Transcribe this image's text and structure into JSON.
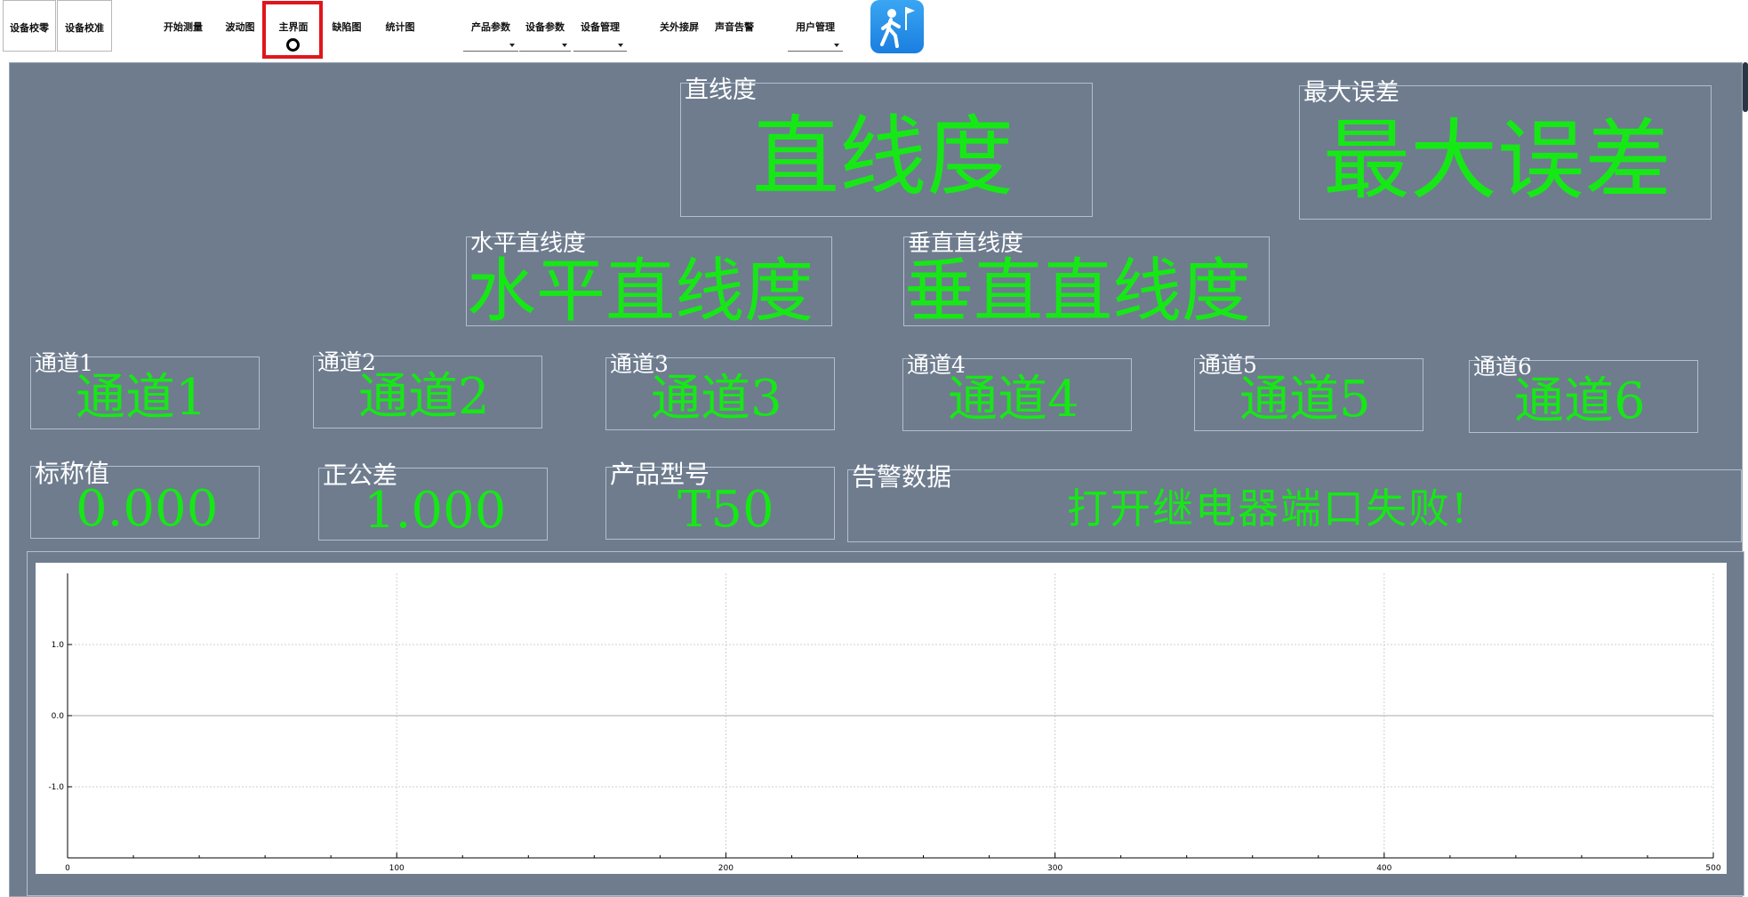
{
  "toolbar": {
    "buttons": [
      {
        "label": "设备校零",
        "dropdown": false
      },
      {
        "label": "设备校准",
        "dropdown": false
      },
      {
        "label": "开始测量",
        "dropdown": false
      },
      {
        "label": "波动图",
        "dropdown": false
      },
      {
        "label": "主界面",
        "dropdown": false,
        "active": true
      },
      {
        "label": "缺陷图",
        "dropdown": false
      },
      {
        "label": "统计图",
        "dropdown": false
      },
      {
        "label": "产品参数",
        "dropdown": true
      },
      {
        "label": "设备参数",
        "dropdown": true
      },
      {
        "label": "设备管理",
        "dropdown": true
      },
      {
        "label": "关外接屏",
        "dropdown": false
      },
      {
        "label": "声音告警",
        "dropdown": false
      },
      {
        "label": "用户管理",
        "dropdown": true
      }
    ],
    "exit_icon": "exit-walking-person-icon",
    "highlight_color": "#e0161c"
  },
  "panels": {
    "straightness": {
      "label": "直线度",
      "value": "直线度"
    },
    "max_error": {
      "label": "最大误差",
      "value": "最大误差"
    },
    "h_straightness": {
      "label": "水平直线度",
      "value": "水平直线度"
    },
    "v_straightness": {
      "label": "垂直直线度",
      "value": "垂直直线度"
    },
    "channels": [
      {
        "label": "通道1",
        "value": "通道1"
      },
      {
        "label": "通道2",
        "value": "通道2"
      },
      {
        "label": "通道3",
        "value": "通道3"
      },
      {
        "label": "通道4",
        "value": "通道4"
      },
      {
        "label": "通道5",
        "value": "通道5"
      },
      {
        "label": "通道6",
        "value": "通道6"
      }
    ],
    "nominal": {
      "label": "标称值",
      "value": "0.000"
    },
    "tolerance": {
      "label": "正公差",
      "value": "1.000"
    },
    "model": {
      "label": "产品型号",
      "value": "T50"
    },
    "alarm": {
      "label": "告警数据",
      "value": "打开继电器端口失败!"
    }
  },
  "colors": {
    "background": "#6e7c8e",
    "value_green": "#16e816",
    "label_white": "#ffffff"
  },
  "chart_data": {
    "type": "line",
    "title": "",
    "xlabel": "",
    "ylabel": "",
    "xlim": [
      0,
      500
    ],
    "ylim": [
      -2,
      2
    ],
    "x_ticks": [
      "0",
      "100",
      "200",
      "300",
      "400",
      "500"
    ],
    "y_ticks": [
      "1.0",
      "0.0",
      "-1.0"
    ],
    "grid": true,
    "series": []
  }
}
